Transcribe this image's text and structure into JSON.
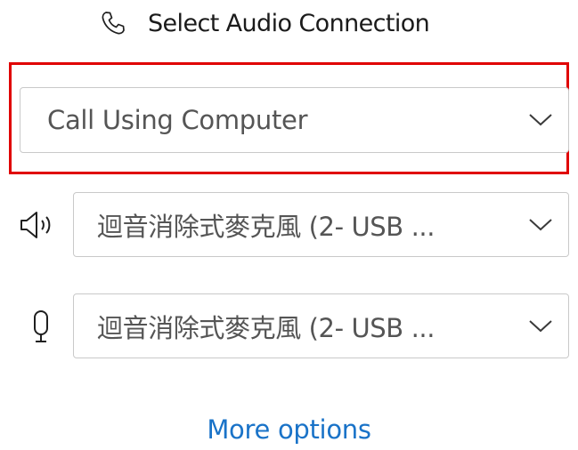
{
  "header": {
    "title": "Select Audio Connection",
    "icon": "phone-icon"
  },
  "connection": {
    "selected": "Call Using Computer",
    "highlight_color": "#e00000"
  },
  "speaker": {
    "selected": "迴音消除式麥克風 (2- USB ...",
    "icon": "speaker-icon"
  },
  "microphone": {
    "selected": "迴音消除式麥克風 (2- USB ...",
    "icon": "microphone-icon"
  },
  "more_options": {
    "label": "More options",
    "color": "#1a73c8"
  }
}
